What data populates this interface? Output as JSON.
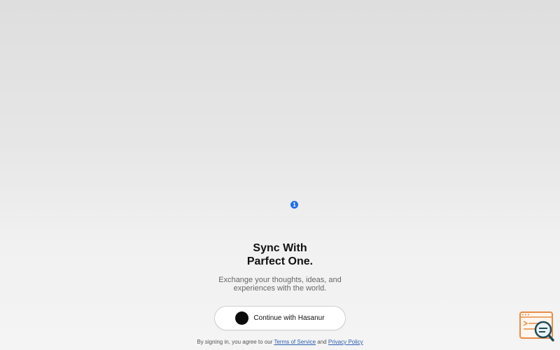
{
  "notification": {
    "count": "1",
    "color": "#1f6feb"
  },
  "auth": {
    "title_line1": "Sync With",
    "title_line2": "Parfect One.",
    "subtitle": "Exchange your thoughts, ideas, and experiences with the world.",
    "continue_button_label": "Continue with Hasanur",
    "terms_prefix": "By signing in, you agree to our",
    "terms_link": "Terms of Service",
    "terms_conjunction": "and",
    "privacy_link": "Privacy Policy"
  },
  "widgets": {
    "inspector": {
      "icon": "search-inspector-icon",
      "color": "#e98b45"
    }
  },
  "colors": {
    "background_top": "#dedede",
    "background_bottom": "#f4f4f4",
    "button_bg": "#ffffff",
    "link": "#2a5db0"
  }
}
